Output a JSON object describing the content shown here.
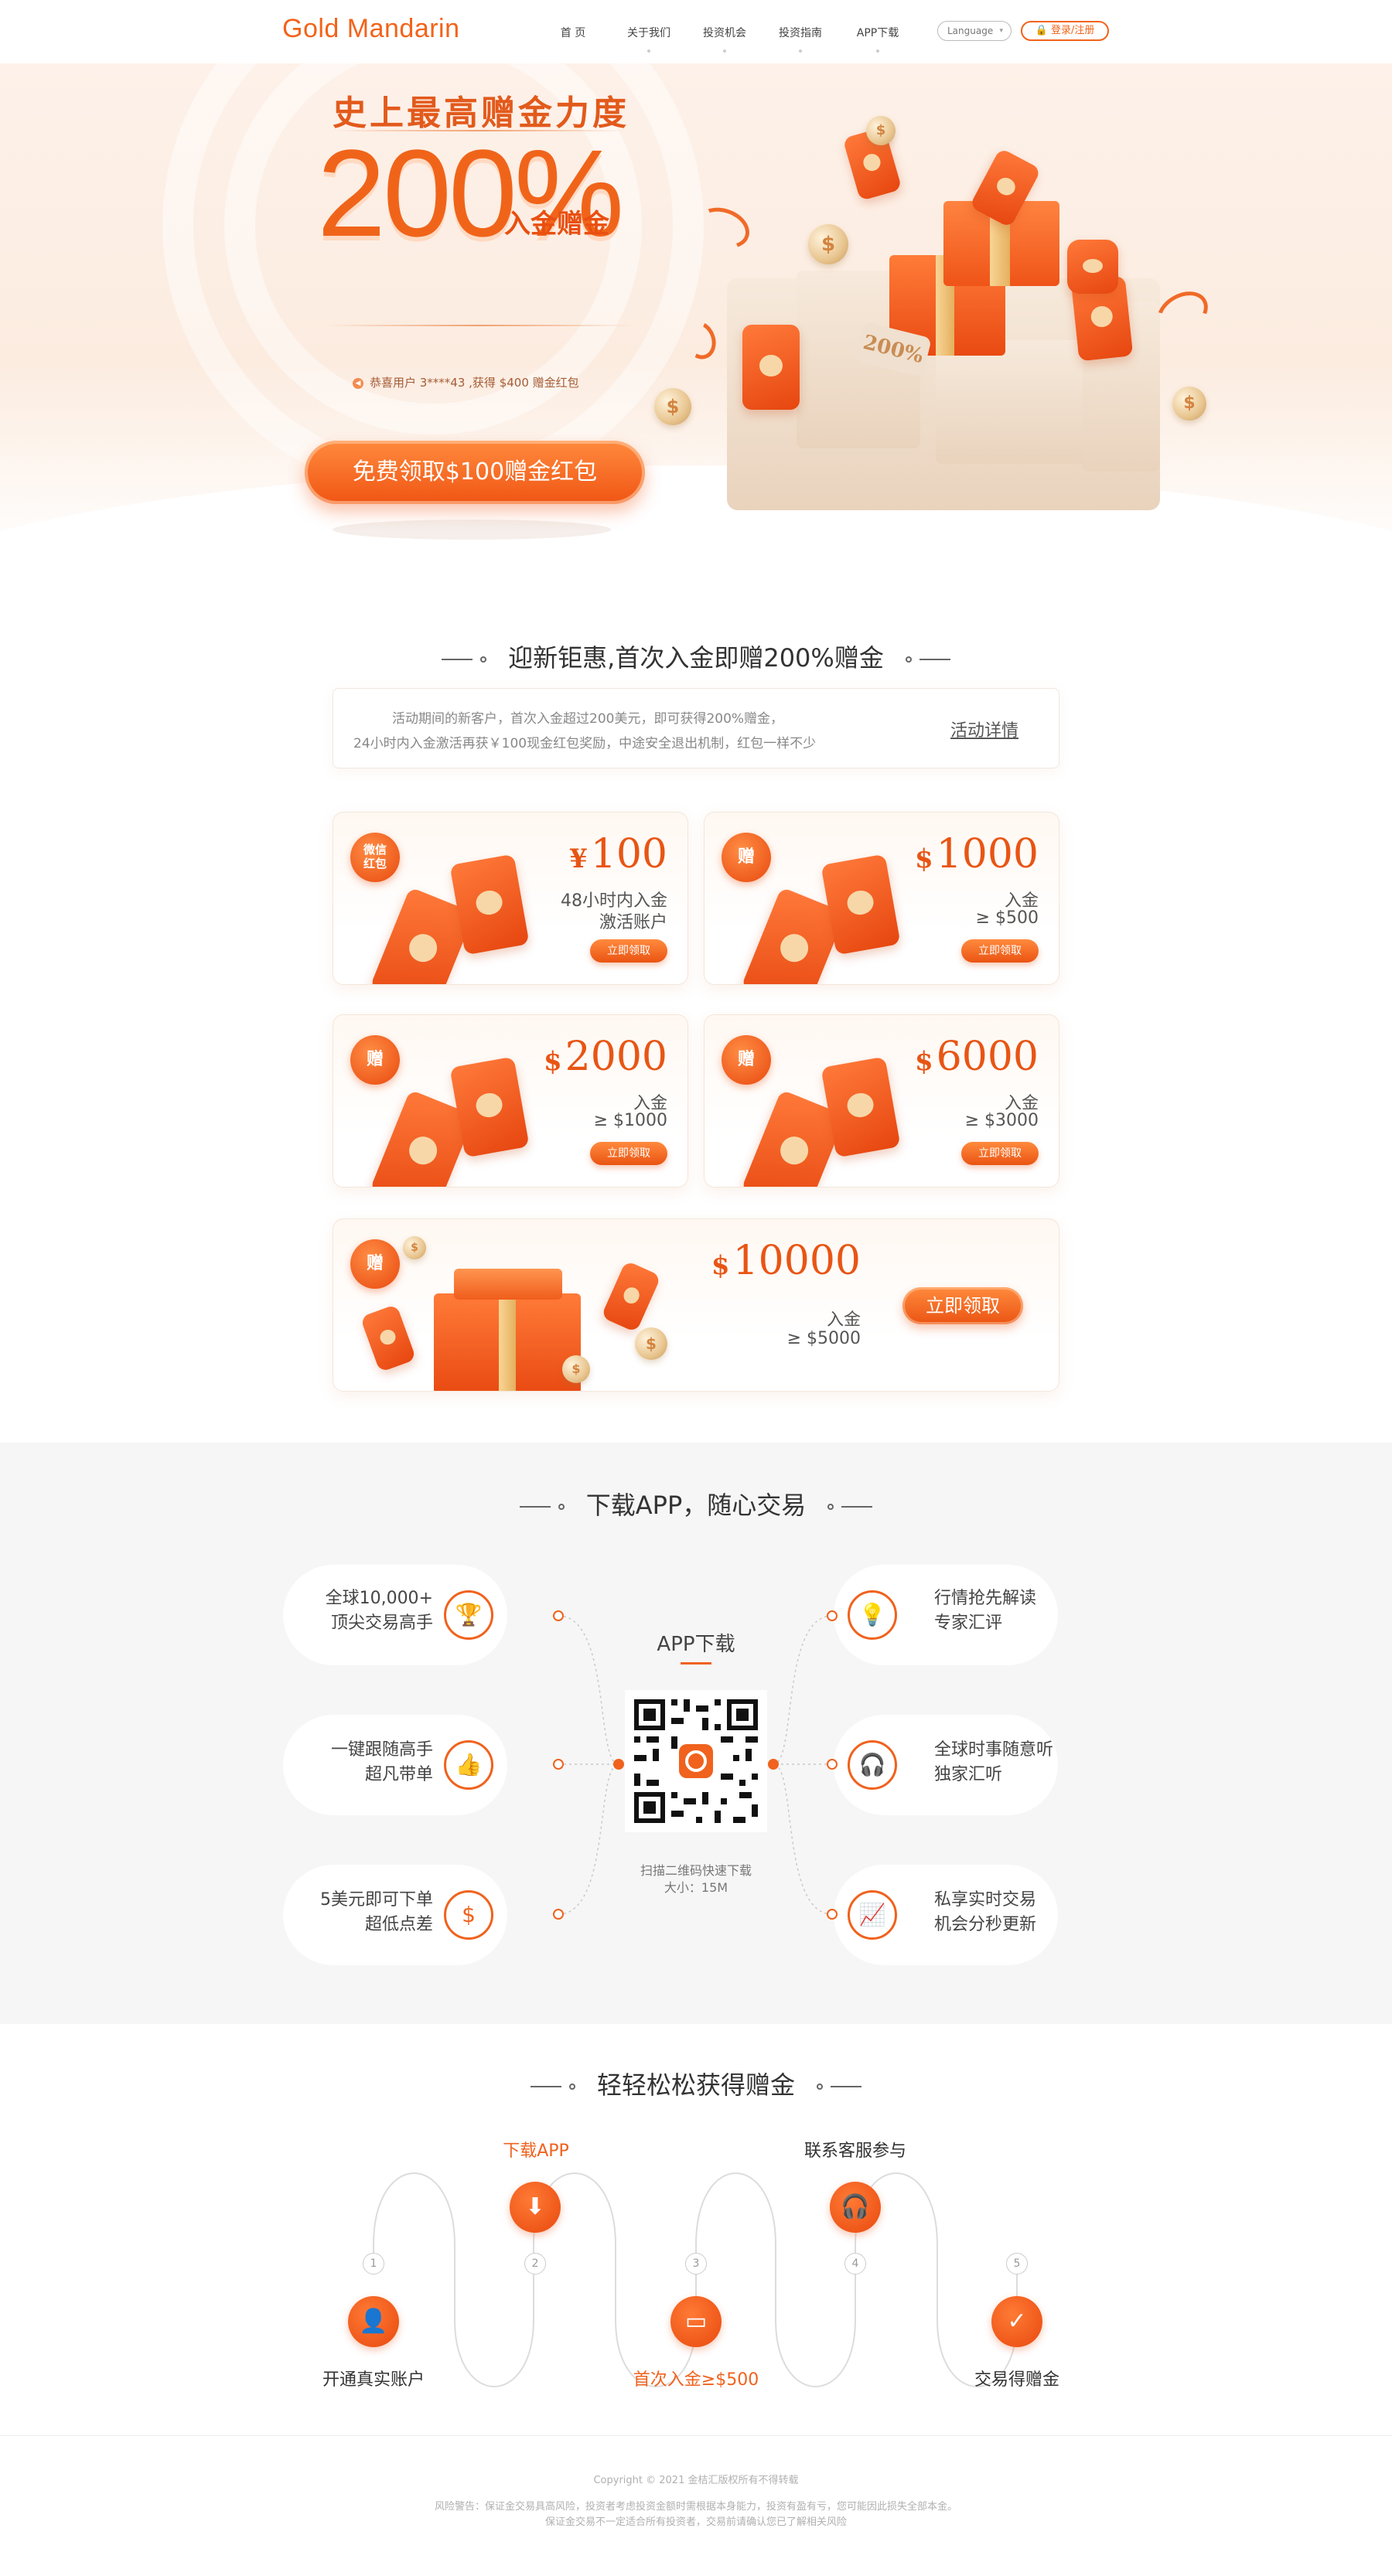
{
  "header": {
    "logo": "Gold Mandarin",
    "nav": [
      "首 页",
      "关于我们",
      "投资机会",
      "投资指南",
      "APP下载"
    ],
    "language": "Language",
    "login": "登录/注册"
  },
  "hero": {
    "title": "史上最高赠金力度",
    "big_number": "200%",
    "big_sub": "入金赠金",
    "ticker": "恭喜用户 3****43 ,获得 $400 赠金红包",
    "cta": "免费领取$100赠金红包",
    "gift_label": "200%"
  },
  "promo": {
    "title": "迎新钜惠,首次入金即赠200%赠金",
    "info_line1": "活动期间的新客户，首次入金超过200美元，即可获得200%赠金，",
    "info_line2": "24小时内入金激活再获￥100现金红包奖励，中途安全退出机制，红包一样不少",
    "details_link": "活动详情",
    "cards": [
      {
        "badge": "微信红包",
        "currency": "¥",
        "amount": "100",
        "line1": "48小时内入金",
        "line2": "激活账户",
        "button": "立即领取"
      },
      {
        "badge": "赠",
        "currency": "$",
        "amount": "1000",
        "line1": "入金",
        "line2": "≥ $500",
        "button": "立即领取"
      },
      {
        "badge": "赠",
        "currency": "$",
        "amount": "2000",
        "line1": "入金",
        "line2": "≥ $1000",
        "button": "立即领取"
      },
      {
        "badge": "赠",
        "currency": "$",
        "amount": "6000",
        "line1": "入金",
        "line2": "≥ $3000",
        "button": "立即领取"
      },
      {
        "badge": "赠",
        "currency": "$",
        "amount": "10000",
        "line1": "入金",
        "line2": "≥ $5000",
        "button": "立即领取"
      }
    ]
  },
  "app": {
    "title": "下载APP，随心交易",
    "qr_title": "APP下载",
    "qr_caption": "扫描二维码快速下载",
    "qr_size": "大小：15M",
    "features_left": [
      {
        "line1": "全球10,000+",
        "line2": "顶尖交易高手",
        "icon": "trophy-icon"
      },
      {
        "line1": "一键跟随高手",
        "line2": "超凡带单",
        "icon": "thumbs-up-icon"
      },
      {
        "line1": "5美元即可下单",
        "line2": "超低点差",
        "icon": "dollar-icon"
      }
    ],
    "features_right": [
      {
        "line1": "行情抢先解读",
        "line2": "专家汇评",
        "icon": "lightbulb-icon"
      },
      {
        "line1": "全球时事随意听",
        "line2": "独家汇听",
        "icon": "headphones-icon"
      },
      {
        "line1": "私享实时交易",
        "line2": "机会分秒更新",
        "icon": "chart-icon"
      }
    ]
  },
  "steps": {
    "title": "轻轻松松获得赠金",
    "items": [
      {
        "num": "1",
        "label": "开通真实账户",
        "icon": "user-add-icon"
      },
      {
        "num": "2",
        "label": "下载APP",
        "icon": "download-icon"
      },
      {
        "num": "3",
        "label": "首次入金≥$500",
        "icon": "card-icon"
      },
      {
        "num": "4",
        "label": "联系客服参与",
        "icon": "headset-icon"
      },
      {
        "num": "5",
        "label": "交易得赠金",
        "icon": "check-icon"
      }
    ]
  },
  "footer": {
    "copyright": "Copyright © 2021 金桔汇版权所有不得转载",
    "risk1": "风险警告：保证金交易具高风险，投资者考虑投资金额时需根据本身能力，投资有盈有亏，您可能因此损失全部本金。",
    "risk2": "保证金交易不一定适合所有投资者，交易前请确认您已了解相关风险"
  },
  "colors": {
    "accent": "#f0621d",
    "accent_dark": "#e8490e",
    "hero_bg": "#fdf1e9",
    "app_bg": "#f6f6f6"
  }
}
